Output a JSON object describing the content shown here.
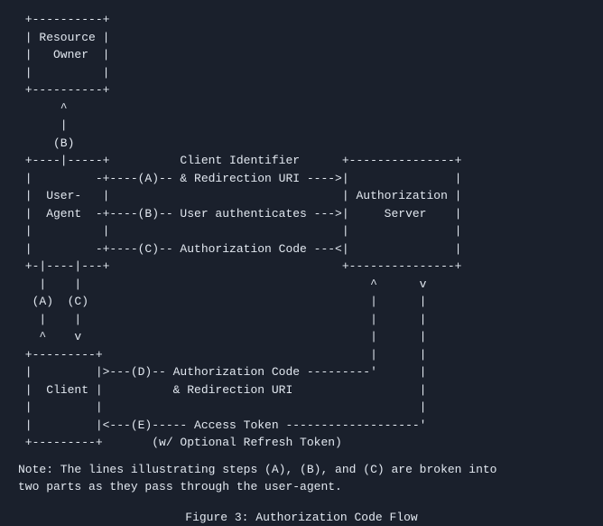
{
  "diagram": {
    "ascii": " +----------+\n | Resource |\n |   Owner  |\n |          |\n +----------+\n      ^\n      |\n     (B)\n +----|-----+          Client Identifier      +---------------+\n |         -+----(A)-- & Redirection URI ---->|               |\n |  User-   |                                 | Authorization |\n |  Agent  -+----(B)-- User authenticates --->|     Server    |\n |          |                                 |               |\n |         -+----(C)-- Authorization Code ---<|               |\n +-|----|---+                                 +---------------+\n   |    |                                         ^      v\n  (A)  (C)                                        |      |\n   |    |                                         |      |\n   ^    v                                         |      |\n +---------+                                      |      |\n |         |>---(D)-- Authorization Code ---------'      |\n |  Client |          & Redirection URI                  |\n |         |                                             |\n |         |<---(E)----- Access Token -------------------'\n +---------+       (w/ Optional Refresh Token)"
  },
  "note": "Note: The lines illustrating steps (A), (B), and (C) are broken into\ntwo parts as they pass through the user-agent.",
  "caption": "Figure 3: Authorization Code Flow",
  "entities": {
    "resource_owner": "Resource Owner",
    "user_agent": "User-Agent",
    "client": "Client",
    "authorization_server": "Authorization Server"
  },
  "steps": {
    "A": "Client Identifier & Redirection URI",
    "B": "User authenticates",
    "C": "Authorization Code",
    "D": "Authorization Code & Redirection URI",
    "E": "Access Token (w/ Optional Refresh Token)"
  }
}
